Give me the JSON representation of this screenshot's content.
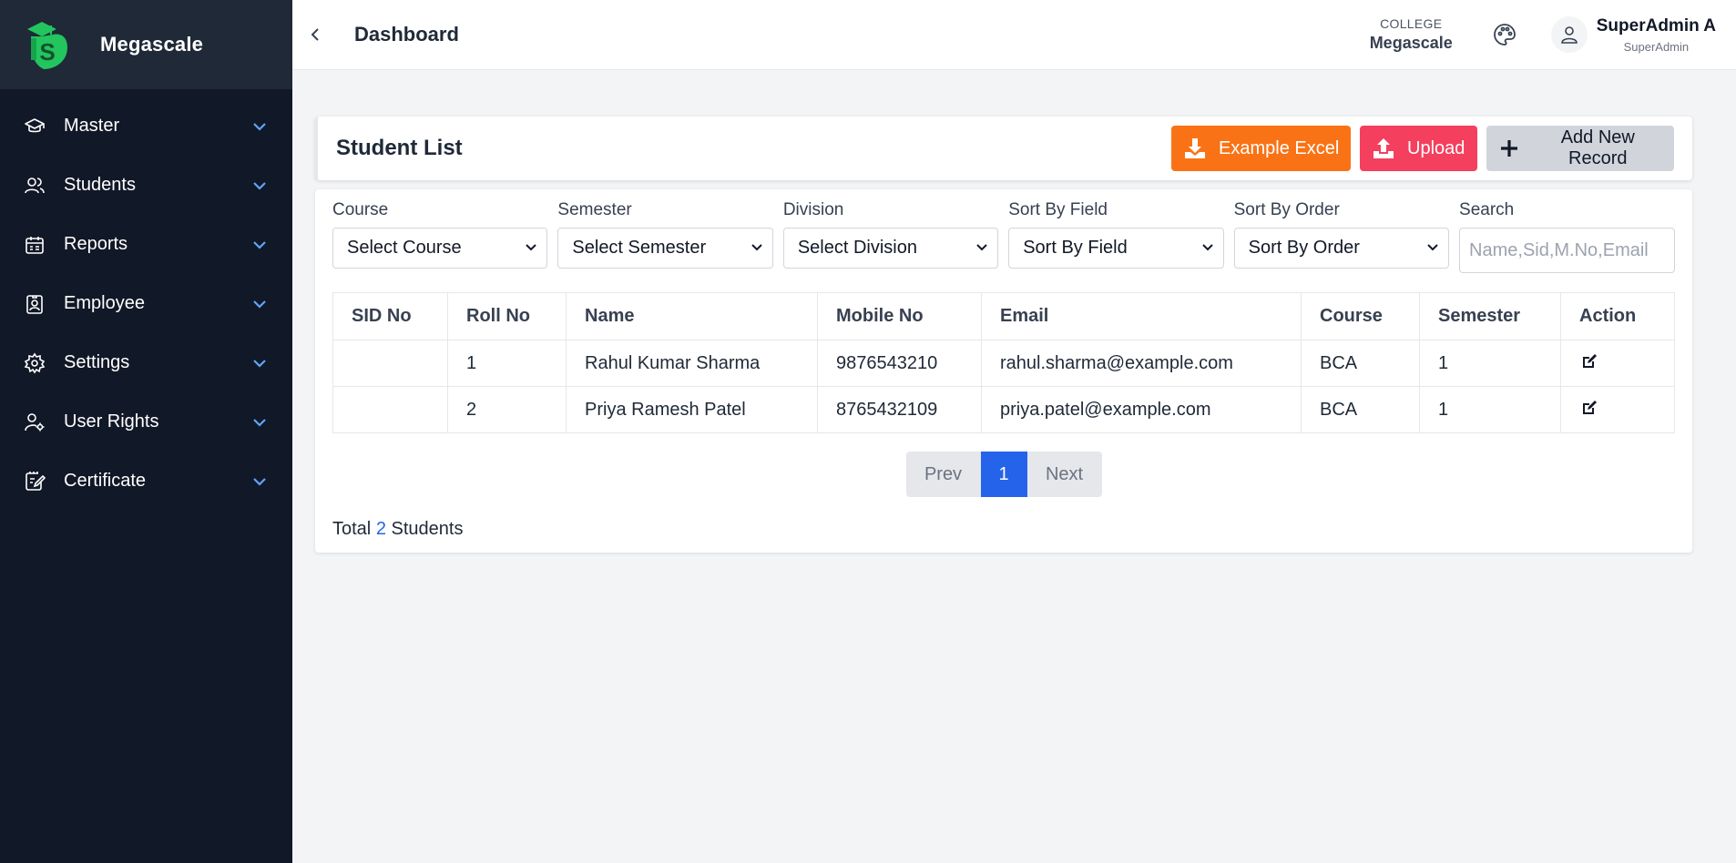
{
  "sidebar": {
    "brand": "Megascale",
    "items": [
      {
        "label": "Master",
        "icon": "graduation-cap-icon"
      },
      {
        "label": "Students",
        "icon": "users-icon"
      },
      {
        "label": "Reports",
        "icon": "calendar-list-icon"
      },
      {
        "label": "Employee",
        "icon": "badge-user-icon"
      },
      {
        "label": "Settings",
        "icon": "gear-icon"
      },
      {
        "label": "User Rights",
        "icon": "user-gear-icon"
      },
      {
        "label": "Certificate",
        "icon": "certificate-edit-icon"
      }
    ]
  },
  "header": {
    "title": "Dashboard",
    "college_label": "COLLEGE",
    "college_name": "Megascale",
    "user_name": "SuperAdmin A",
    "user_role": "SuperAdmin"
  },
  "card": {
    "title": "Student List",
    "buttons": {
      "excel": "Example Excel",
      "upload": "Upload",
      "add": "Add New Record"
    }
  },
  "filters": {
    "course": {
      "label": "Course",
      "value": "Select Course"
    },
    "semester": {
      "label": "Semester",
      "value": "Select Semester"
    },
    "division": {
      "label": "Division",
      "value": "Select Division"
    },
    "sort_field": {
      "label": "Sort By Field",
      "value": "Sort By Field"
    },
    "sort_order": {
      "label": "Sort By Order",
      "value": "Sort By Order"
    },
    "search": {
      "label": "Search",
      "placeholder": "Name,Sid,M.No,Email"
    }
  },
  "table": {
    "headers": [
      "SID No",
      "Roll No",
      "Name",
      "Mobile No",
      "Email",
      "Course",
      "Semester",
      "Action"
    ],
    "rows": [
      {
        "sid": "",
        "roll": "1",
        "name": "Rahul Kumar Sharma",
        "mobile": "9876543210",
        "email": "rahul.sharma@example.com",
        "course": "BCA",
        "semester": "1"
      },
      {
        "sid": "",
        "roll": "2",
        "name": "Priya Ramesh Patel",
        "mobile": "8765432109",
        "email": "priya.patel@example.com",
        "course": "BCA",
        "semester": "1"
      }
    ]
  },
  "pagination": {
    "prev": "Prev",
    "current": "1",
    "next": "Next"
  },
  "total": {
    "prefix": "Total",
    "count": "2",
    "suffix": "Students"
  },
  "colors": {
    "sidebar_bg": "#111827",
    "brand_bg": "#1f2937",
    "accent_blue": "#2563eb",
    "excel_orange": "#f97316",
    "upload_red": "#f43f5e",
    "chevron_blue": "#60a5fa",
    "logo_green": "#22c55e"
  }
}
